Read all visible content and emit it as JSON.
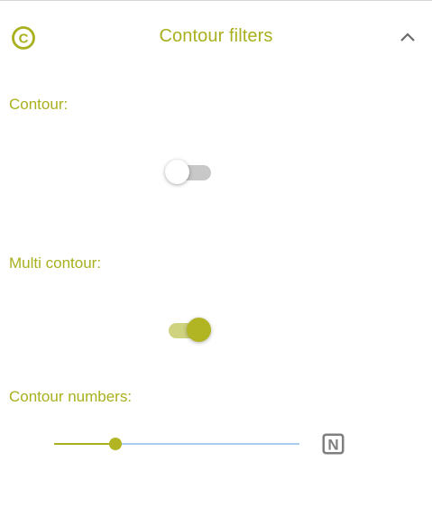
{
  "header": {
    "title": "Contour filters",
    "logo_letter": "C",
    "logo_icon": "copyright-circle-icon",
    "collapse_icon": "chevron-up-icon"
  },
  "contour": {
    "label": "Contour:",
    "enabled": false
  },
  "multi_contour": {
    "label": "Multi contour:",
    "enabled": true
  },
  "contour_numbers": {
    "label": "Contour numbers:",
    "value_fraction": 0.25,
    "badge_letter": "N",
    "badge_icon": "n-badge-icon"
  },
  "colors": {
    "accent": "#a8b01d",
    "rail": "#a9cdee",
    "badge": "#7f7f7f"
  }
}
